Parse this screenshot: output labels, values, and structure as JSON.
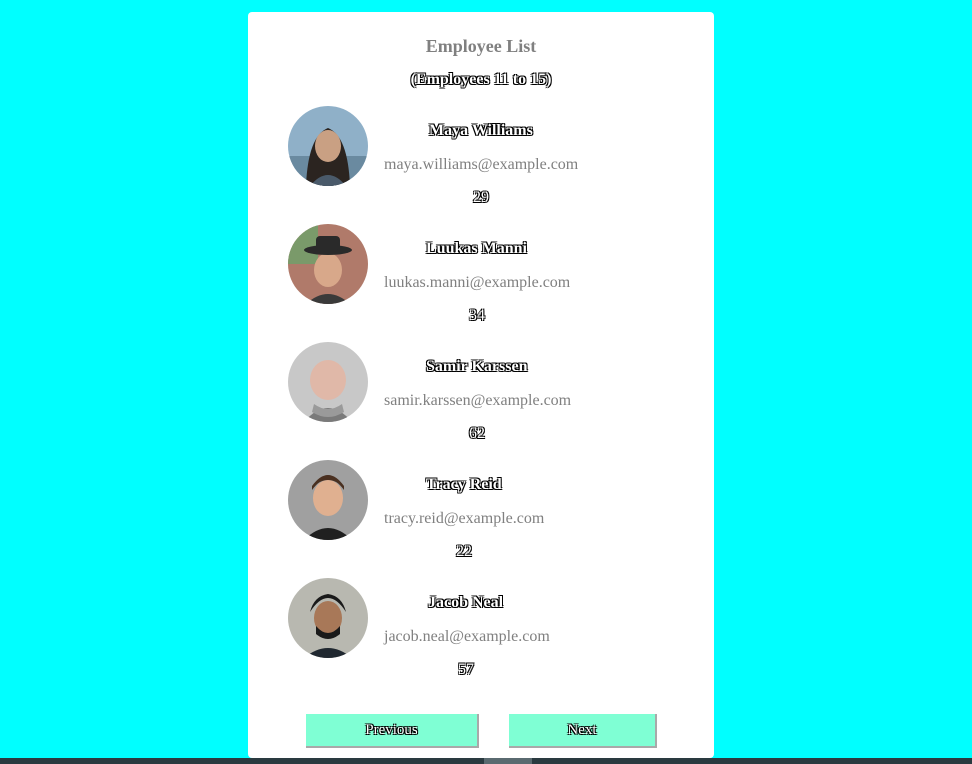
{
  "header": {
    "title": "Employee List",
    "subtitle": "(Employees 11 to 15)"
  },
  "employees": [
    {
      "name": "Maya Williams",
      "email": "maya.williams@example.com",
      "age": "29",
      "avatar_icon": "person-photo"
    },
    {
      "name": "Luukas Manni",
      "email": "luukas.manni@example.com",
      "age": "34",
      "avatar_icon": "person-photo"
    },
    {
      "name": "Samir Karssen",
      "email": "samir.karssen@example.com",
      "age": "62",
      "avatar_icon": "person-photo"
    },
    {
      "name": "Tracy Reid",
      "email": "tracy.reid@example.com",
      "age": "22",
      "avatar_icon": "person-photo"
    },
    {
      "name": "Jacob Neal",
      "email": "jacob.neal@example.com",
      "age": "57",
      "avatar_icon": "person-photo"
    }
  ],
  "pagination": {
    "previous_label": "Previous",
    "next_label": "Next"
  },
  "colors": {
    "page_background": "#00ffff",
    "card_background": "#ffffff",
    "button_background": "#7fffd4",
    "muted_text": "#808080"
  }
}
